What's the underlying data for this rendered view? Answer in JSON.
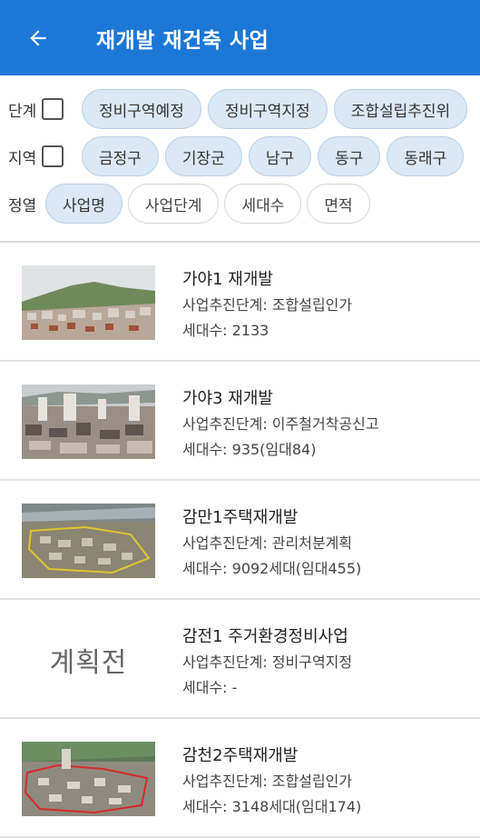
{
  "appbar": {
    "title": "재개발 재건축 사업",
    "back_icon": "arrow-left-icon"
  },
  "filters": {
    "stage": {
      "label": "단계",
      "chips": [
        {
          "label": "정비구역예정",
          "selected": true
        },
        {
          "label": "정비구역지정",
          "selected": true
        },
        {
          "label": "조합설립추진위",
          "selected": true
        }
      ]
    },
    "region": {
      "label": "지역",
      "chips": [
        {
          "label": "금정구",
          "selected": true
        },
        {
          "label": "기장군",
          "selected": true
        },
        {
          "label": "남구",
          "selected": true
        },
        {
          "label": "동구",
          "selected": true
        },
        {
          "label": "동래구",
          "selected": true
        }
      ]
    },
    "sort": {
      "label": "정열",
      "chips": [
        {
          "label": "사업명",
          "selected": true
        },
        {
          "label": "사업단계",
          "selected": false
        },
        {
          "label": "세대수",
          "selected": false
        },
        {
          "label": "면적",
          "selected": false
        }
      ]
    }
  },
  "projects": [
    {
      "title": "가야1 재개발",
      "stage": "사업추진단계: 조합설립인가",
      "households": "세대수: 2133"
    },
    {
      "title": "가야3 재개발",
      "stage": "사업추진단계: 이주철거착공신고",
      "households": "세대수: 935(임대84)"
    },
    {
      "title": "감만1주택재개발",
      "stage": "사업추진단계: 관리처분계획",
      "households": "세대수: 9092세대(임대455)"
    },
    {
      "title": "감전1 주거환경정비사업",
      "stage": "사업추진단계: 정비구역지정",
      "households": "세대수: -",
      "placeholder": "계획전"
    },
    {
      "title": "감천2주택재개발",
      "stage": "사업추진단계: 조합설립인가",
      "households": "세대수: 3148세대(임대174)"
    }
  ],
  "colors": {
    "appbar": "#1c77d6",
    "chip_selected": "#dbe8f5"
  }
}
